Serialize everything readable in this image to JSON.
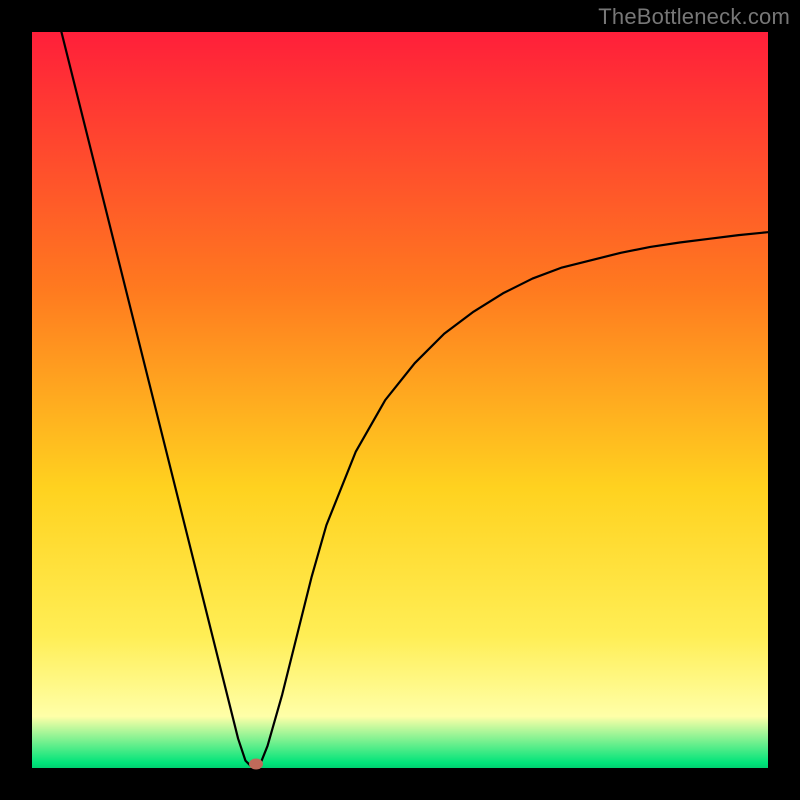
{
  "watermark": "TheBottleneck.com",
  "colors": {
    "frame": "#000000",
    "gradient_top": "#ff1f3a",
    "gradient_mid1": "#ff7a1f",
    "gradient_mid2": "#ffd21f",
    "gradient_yellow": "#ffee55",
    "gradient_paleyellow": "#ffffa8",
    "gradient_green": "#00e47a",
    "curve": "#000000",
    "marker": "#c06a5a"
  },
  "chart_data": {
    "type": "line",
    "title": "",
    "xlabel": "",
    "ylabel": "",
    "xlim": [
      0,
      100
    ],
    "ylim": [
      0,
      100
    ],
    "series": [
      {
        "name": "bottleneck-curve",
        "x": [
          4,
          6,
          8,
          10,
          12,
          14,
          16,
          18,
          20,
          22,
          24,
          26,
          28,
          29,
          30,
          31,
          32,
          34,
          36,
          38,
          40,
          44,
          48,
          52,
          56,
          60,
          64,
          68,
          72,
          76,
          80,
          84,
          88,
          92,
          96,
          100
        ],
        "y": [
          100,
          92,
          84,
          76,
          68,
          60,
          52,
          44,
          36,
          28,
          20,
          12,
          4,
          1,
          0,
          0.5,
          3,
          10,
          18,
          26,
          33,
          43,
          50,
          55,
          59,
          62,
          64.5,
          66.5,
          68,
          69,
          70,
          70.8,
          71.4,
          71.9,
          72.4,
          72.8
        ]
      }
    ],
    "annotations": [
      {
        "name": "min-marker",
        "x": 30.5,
        "y": 0.5
      }
    ]
  }
}
